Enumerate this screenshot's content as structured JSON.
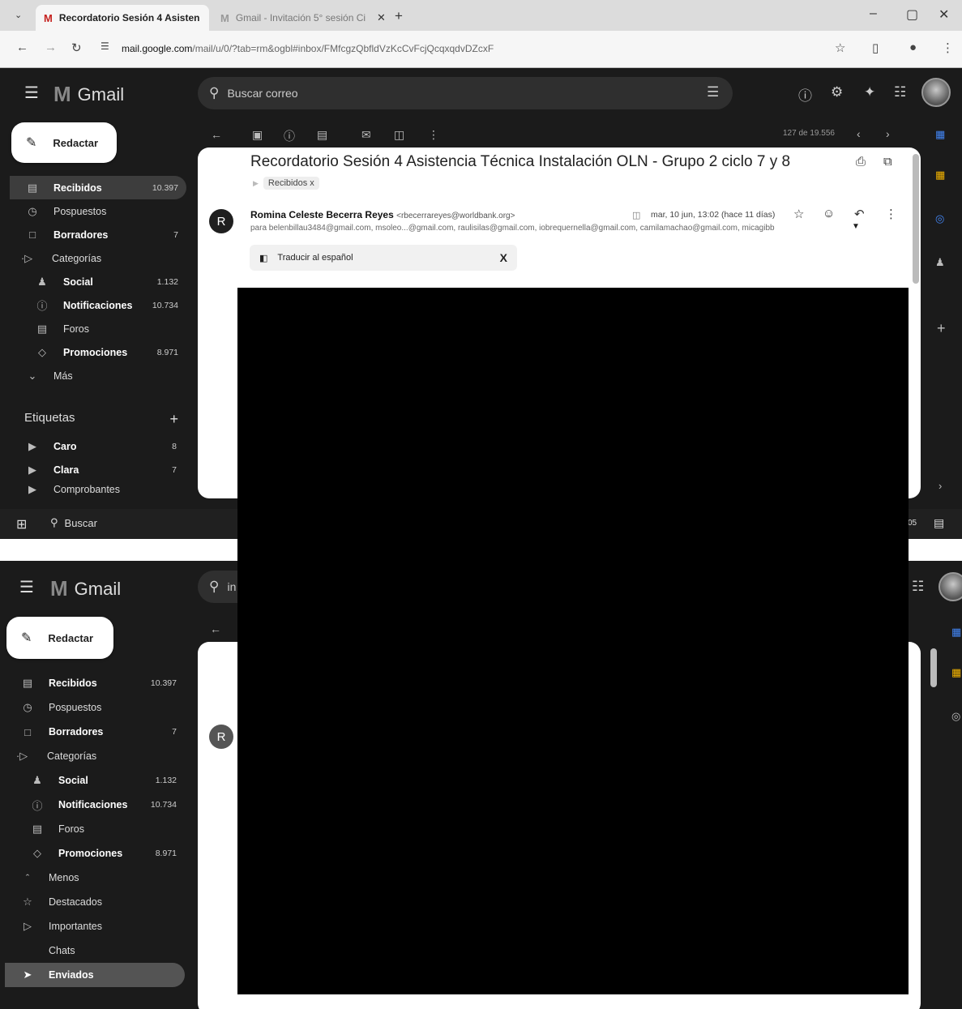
{
  "browser": {
    "tabs": [
      {
        "label": "Recordatorio Sesión 4 Asisten",
        "active": true
      },
      {
        "label": "Gmail - Invitación 5° sesión Ci",
        "active": false
      }
    ],
    "new_tab_label": "+",
    "url_host": "mail.google.com",
    "url_path": "/mail/u/0/?tab=rm&ogbl#inbox/FMfcgzQbfldVzKcCvFcjQcqxqdvDZcxF"
  },
  "gmail": {
    "logo_text": "Gmail",
    "search_placeholder": "Buscar correo",
    "search_query_partial": "in",
    "compose_label": "Redactar",
    "nav": [
      {
        "label": "Recibidos",
        "count": "10.397"
      },
      {
        "label": "Pospuestos",
        "count": ""
      },
      {
        "label": "Borradores",
        "count": "7"
      },
      {
        "label": "Categorías",
        "count": ""
      },
      {
        "label": "Social",
        "count": "1.132"
      },
      {
        "label": "Notificaciones",
        "count": "10.734"
      },
      {
        "label": "Foros",
        "count": ""
      },
      {
        "label": "Promociones",
        "count": "8.971"
      },
      {
        "label": "Más",
        "count": ""
      }
    ],
    "nav2_extra": [
      {
        "label": "Menos"
      },
      {
        "label": "Destacados"
      },
      {
        "label": "Importantes"
      },
      {
        "label": "Chats"
      },
      {
        "label": "Enviados"
      }
    ],
    "labels_title": "Etiquetas",
    "labels_add": "+",
    "labels": [
      {
        "label": "Caro",
        "count": "8"
      },
      {
        "label": "Clara",
        "count": "7"
      },
      {
        "label": "Comprobantes",
        "count": ""
      }
    ],
    "pager": "127 de 19.556"
  },
  "email": {
    "subject": "Recordatorio Sesión 4 Asistencia Técnica Instalación OLN - Grupo 2 ciclo 7 y 8",
    "label_chip": "Recibidos",
    "label_chip_close": "x",
    "avatar_letter": "R",
    "sender_name": "Romina Celeste Becerra Reyes",
    "sender_email": "<rbecerrareyes@worldbank.org>",
    "date": "mar, 10 jun, 13:02 (hace 11 días)",
    "recipients": "para belenbillau3484@gmail.com, msoleo...@gmail.com, raulisilas@gmail.com, iobrequernella@gmail.com, camilamachao@gmail.com, micagibb",
    "translate_label": "Traducir al español",
    "translate_close": "X"
  },
  "taskbar": {
    "search_label": "Buscar",
    "time_fragment": "05"
  }
}
